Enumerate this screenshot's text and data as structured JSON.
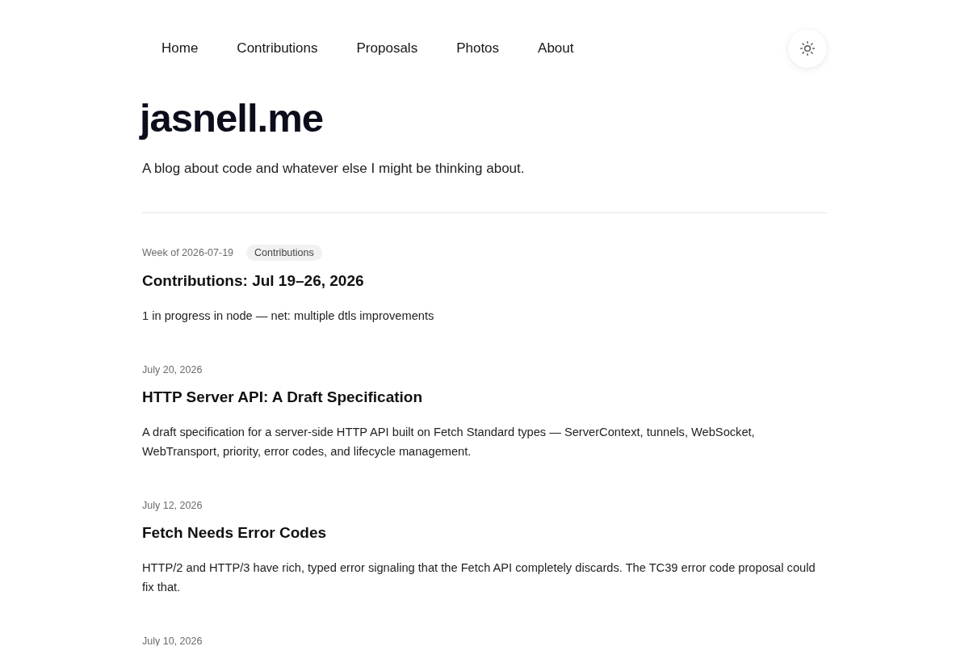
{
  "nav": {
    "links": [
      {
        "label": "Home"
      },
      {
        "label": "Contributions"
      },
      {
        "label": "Proposals"
      },
      {
        "label": "Photos"
      },
      {
        "label": "About"
      }
    ]
  },
  "site": {
    "title": "jasnell.me",
    "tagline": "A blog about code and whatever else I might be thinking about."
  },
  "posts": [
    {
      "date": "Week of 2026-07-19",
      "tag": "Contributions",
      "title": "Contributions: Jul 19–26, 2026",
      "summary": "1 in progress in node — net: multiple dtls improvements"
    },
    {
      "date": "July 20, 2026",
      "title": "HTTP Server API: A Draft Specification",
      "summary": "A draft specification for a server-side HTTP API built on Fetch Standard types — ServerContext, tunnels, WebSocket, WebTransport, priority, error codes, and lifecycle management."
    },
    {
      "date": "July 12, 2026",
      "title": "Fetch Needs Error Codes",
      "summary": "HTTP/2 and HTTP/3 have rich, typed error signaling that the Fetch API completely discards. The TC39 error code proposal could fix that."
    },
    {
      "date": "July 10, 2026"
    }
  ]
}
